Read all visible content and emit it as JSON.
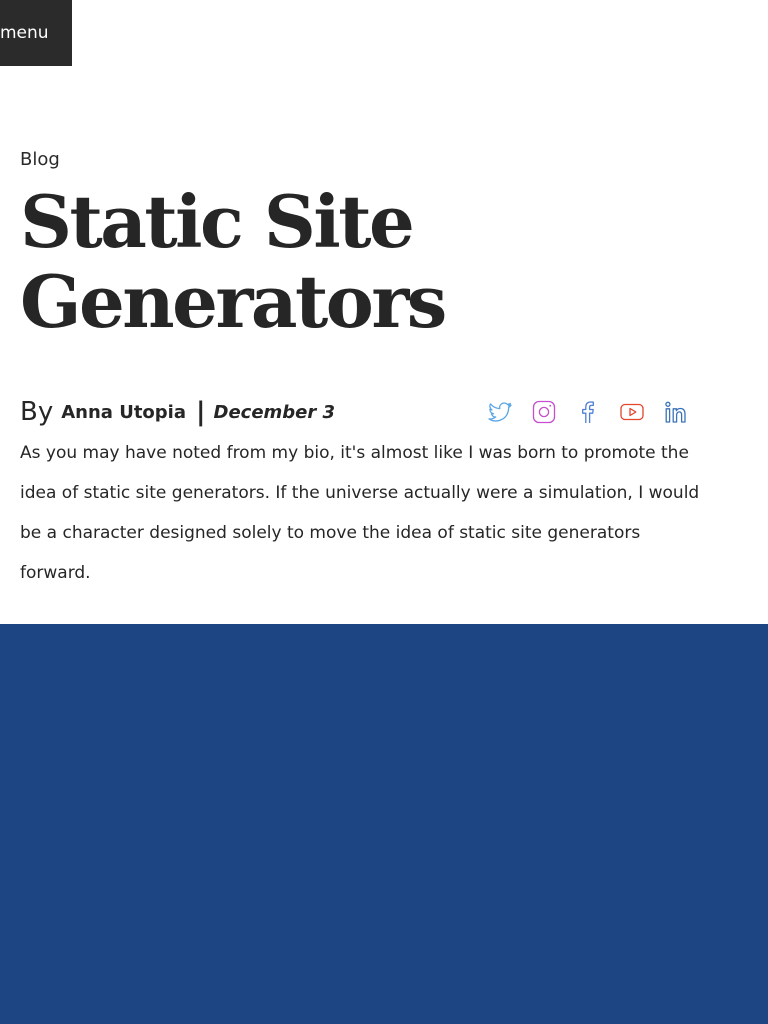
{
  "nav": {
    "menu_label": "menu"
  },
  "breadcrumb": {
    "label": "Blog"
  },
  "article": {
    "title": "Static Site Generators",
    "by_label": "By",
    "author": "Anna Utopia",
    "separator": "|",
    "date": "December 3",
    "intro": "As you may have noted from my bio, it's almost like I was born to promote the idea of static site generators. If the universe actually were a simulation, I would be a character designed solely to move the idea of static site generators forward."
  },
  "social": [
    {
      "icon": "twitter-icon",
      "color": "#5aa7e6"
    },
    {
      "icon": "instagram-icon",
      "color": "#c44fd1"
    },
    {
      "icon": "facebook-icon",
      "color": "#4f7fd6"
    },
    {
      "icon": "youtube-icon",
      "color": "#e5452b"
    },
    {
      "icon": "linkedin-icon",
      "color": "#3a73b8"
    }
  ],
  "colors": {
    "menu_bg": "#2b2b2b",
    "text": "#262626",
    "hero_block": "#1d4483"
  }
}
